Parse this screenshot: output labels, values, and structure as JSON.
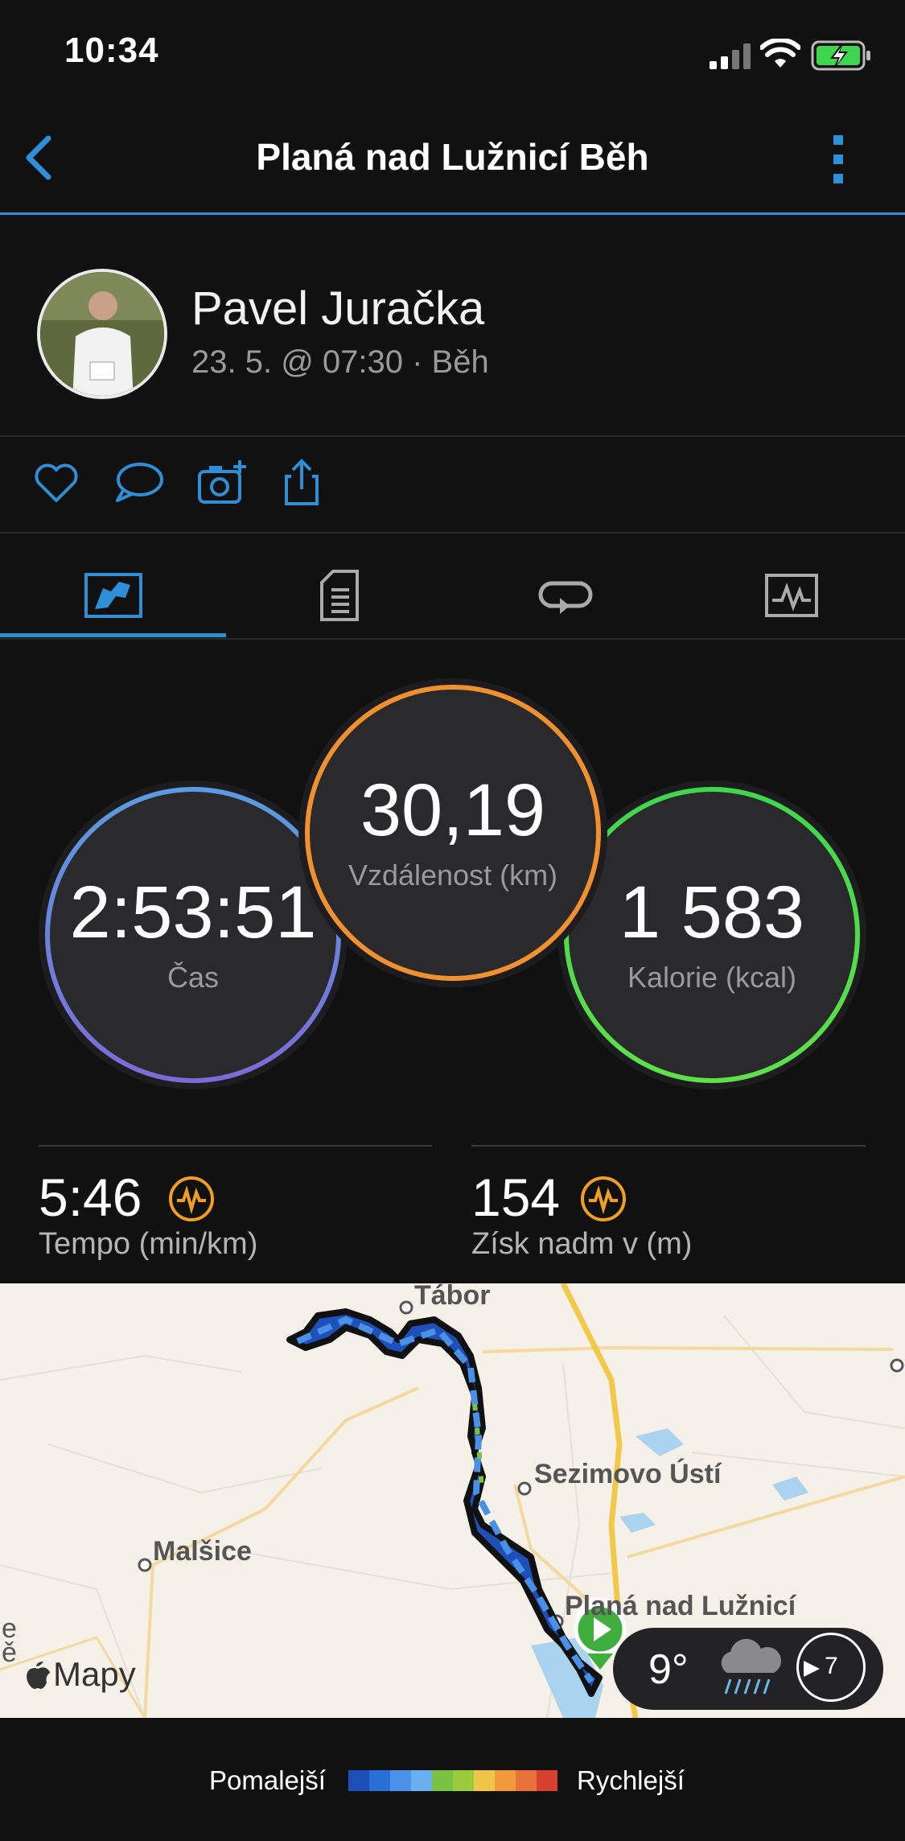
{
  "status_bar": {
    "time": "10:34"
  },
  "nav": {
    "title": "Planá nad Lužnicí Běh"
  },
  "profile": {
    "name": "Pavel Juračka",
    "meta": "23. 5. @ 07:30 · Běh"
  },
  "stats": {
    "time": {
      "value": "2:53:51",
      "label": "Čas"
    },
    "distance": {
      "value": "30,19",
      "label": "Vzdálenost (km)"
    },
    "calories": {
      "value": "1 583",
      "label": "Kalorie (kcal)"
    },
    "pace": {
      "value": "5:46",
      "label": "Tempo (min/km)"
    },
    "elevation": {
      "value": "154",
      "label": "Získ nadm v (m)"
    }
  },
  "map": {
    "labels": {
      "tabor": "Tábor",
      "sezimovo": "Sezimovo Ústí",
      "malsice": "Malšice",
      "plana": "Planá nad Lužnicí",
      "edge_e": "e",
      "edge_e2": "ě"
    },
    "brand": "Mapy",
    "weather": {
      "temp": "9°",
      "wind": "7"
    }
  },
  "legend": {
    "slower": "Pomalejší",
    "faster": "Rychlejší",
    "colors": [
      "#1f4fb8",
      "#2a6fd6",
      "#4a90e6",
      "#6ab0f0",
      "#7cc242",
      "#9acb3c",
      "#f0c64a",
      "#f09a3c",
      "#e8733a",
      "#d8402f"
    ]
  },
  "colors": {
    "accent": "#2f8fd6",
    "ring_time": "#5b9be0",
    "ring_distance": "#f0902e",
    "ring_calories": "#3fd64f",
    "badge": "#f0a020"
  }
}
